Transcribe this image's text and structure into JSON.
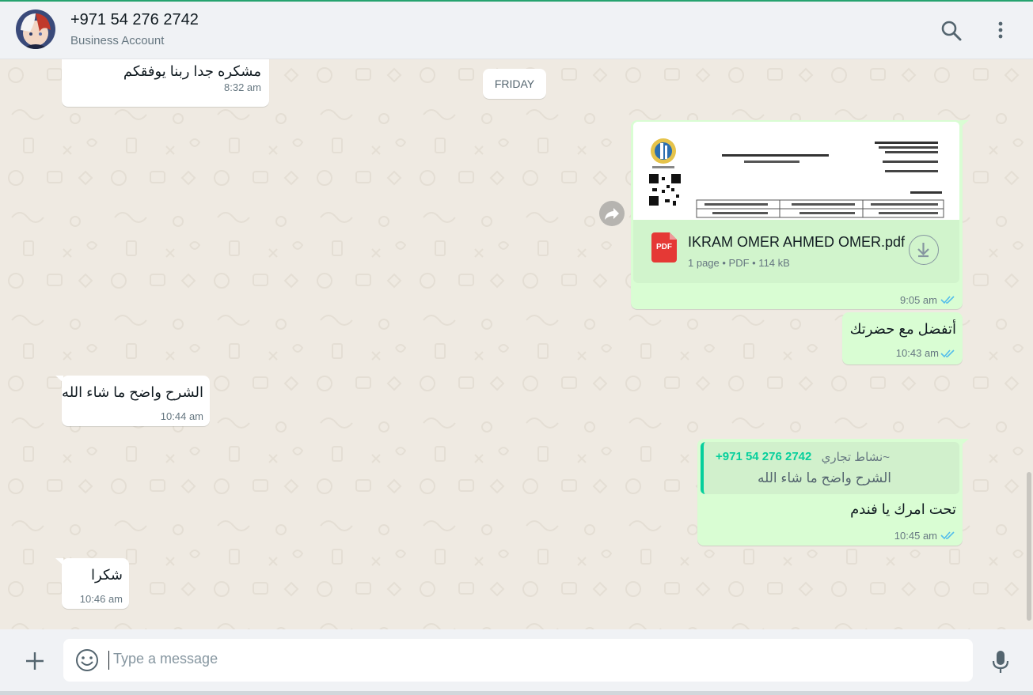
{
  "header": {
    "contact_name": "+971 54 276 2742",
    "contact_subtitle": "Business Account",
    "icons": [
      "search-icon",
      "more-options-icon"
    ]
  },
  "chat": {
    "date_chip": "FRIDAY",
    "messages": [
      {
        "direction": "incoming",
        "text": "مشكره جدا ربنا يوفقكم",
        "time": "8:32 am"
      },
      {
        "direction": "outgoing",
        "type": "document",
        "file_name": "IKRAM OMER AHMED OMER.pdf",
        "file_icon_label": "PDF",
        "file_info": "1 page • PDF • 114 kB",
        "time": "9:05 am",
        "status": "read"
      },
      {
        "direction": "outgoing",
        "text": "أتفضل مع حضرتك",
        "time": "10:43 am",
        "status": "read"
      },
      {
        "direction": "incoming",
        "text": "الشرح واضح ما شاء الله",
        "time": "10:44 am"
      },
      {
        "direction": "outgoing",
        "quoted_author": "~نشاط تجاري",
        "quoted_phone": "+971 54 276 2742",
        "quoted_text": "الشرح واضح ما شاء الله",
        "text": "تحت امرك يا فندم",
        "time": "10:45 am",
        "status": "read"
      },
      {
        "direction": "incoming",
        "text": "شكرا",
        "time": "10:46 am"
      }
    ],
    "read_tick_color": "#53bdeb"
  },
  "footer": {
    "input_placeholder": "Type a message",
    "icons": [
      "plus-icon",
      "emoji-icon",
      "microphone-icon"
    ]
  },
  "colors": {
    "outgoing_bubble": "#d9fdd3",
    "incoming_bubble": "#ffffff",
    "chat_background": "#efeae2",
    "accent": "#06cf9c"
  }
}
